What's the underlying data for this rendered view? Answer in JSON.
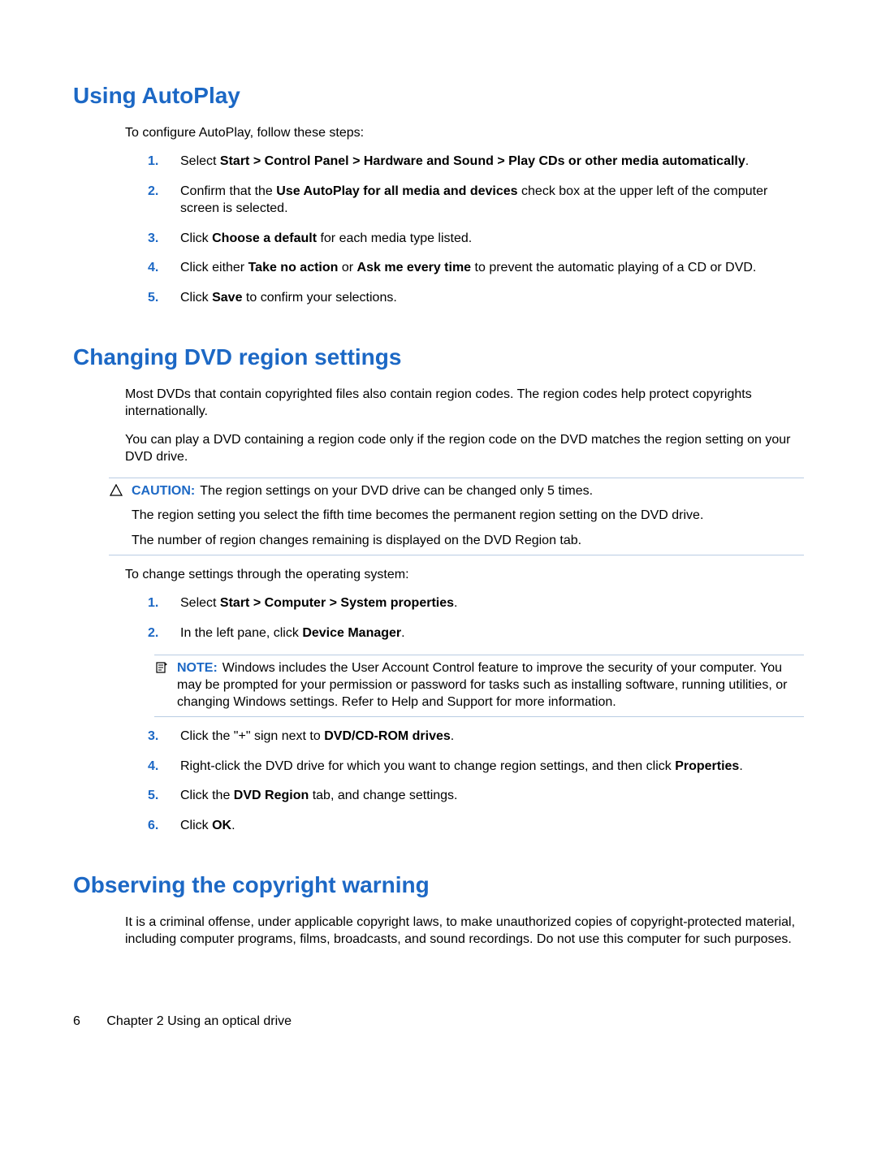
{
  "sections": {
    "autoplay": {
      "heading": "Using AutoPlay",
      "intro": "To configure AutoPlay, follow these steps:",
      "steps": {
        "s1": {
          "num": "1.",
          "pre": "Select ",
          "bold": "Start > Control Panel > Hardware and Sound > Play CDs or other media automatically",
          "post": "."
        },
        "s2": {
          "num": "2.",
          "pre": "Confirm that the ",
          "bold": "Use AutoPlay for all media and devices",
          "post": " check box at the upper left of the computer screen is selected."
        },
        "s3": {
          "num": "3.",
          "pre": "Click ",
          "bold": "Choose a default",
          "post": " for each media type listed."
        },
        "s4": {
          "num": "4.",
          "pre": "Click either ",
          "bold1": "Take no action",
          "mid": " or ",
          "bold2": "Ask me every time",
          "post": " to prevent the automatic playing of a CD or DVD."
        },
        "s5": {
          "num": "5.",
          "pre": "Click ",
          "bold": "Save",
          "post": " to confirm your selections."
        }
      }
    },
    "dvdregion": {
      "heading": "Changing DVD region settings",
      "p1": "Most DVDs that contain copyrighted files also contain region codes. The region codes help protect copyrights internationally.",
      "p2": "You can play a DVD containing a region code only if the region code on the DVD matches the region setting on your DVD drive.",
      "caution": {
        "label": "CAUTION:",
        "line1": "The region settings on your DVD drive can be changed only 5 times.",
        "line2": "The region setting you select the fifth time becomes the permanent region setting on the DVD drive.",
        "line3": "The number of region changes remaining is displayed on the DVD Region tab."
      },
      "p3": "To change settings through the operating system:",
      "steps": {
        "s1": {
          "num": "1.",
          "pre": "Select ",
          "bold": "Start > Computer > System properties",
          "post": "."
        },
        "s2": {
          "num": "2.",
          "pre": "In the left pane, click ",
          "bold": "Device Manager",
          "post": "."
        },
        "note": {
          "label": "NOTE:",
          "text": "Windows includes the User Account Control feature to improve the security of your computer. You may be prompted for your permission or password for tasks such as installing software, running utilities, or changing Windows settings. Refer to Help and Support for more information."
        },
        "s3": {
          "num": "3.",
          "pre": "Click the \"+\" sign next to ",
          "bold": "DVD/CD-ROM drives",
          "post": "."
        },
        "s4": {
          "num": "4.",
          "pre": "Right-click the DVD drive for which you want to change region settings, and then click ",
          "bold": "Properties",
          "post": "."
        },
        "s5": {
          "num": "5.",
          "pre": "Click the ",
          "bold": "DVD Region",
          "post": " tab, and change settings."
        },
        "s6": {
          "num": "6.",
          "pre": "Click ",
          "bold": "OK",
          "post": "."
        }
      }
    },
    "copyright": {
      "heading": "Observing the copyright warning",
      "p1": "It is a criminal offense, under applicable copyright laws, to make unauthorized copies of copyright-protected material, including computer programs, films, broadcasts, and sound recordings. Do not use this computer for such purposes."
    }
  },
  "footer": {
    "page_number": "6",
    "chapter": "Chapter 2   Using an optical drive"
  }
}
